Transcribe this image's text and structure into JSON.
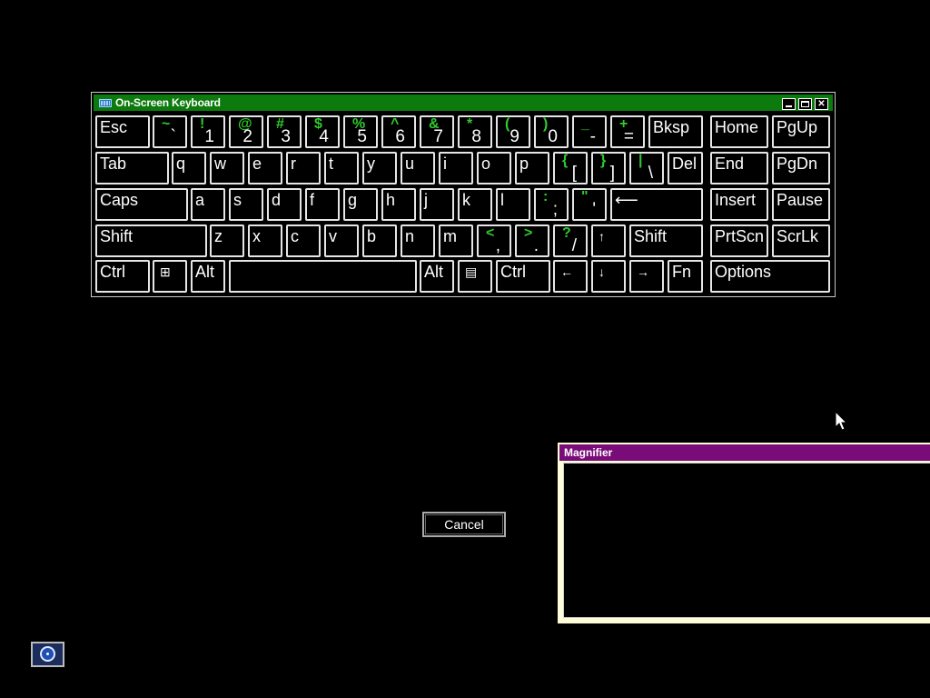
{
  "osk": {
    "title": "On-Screen Keyboard",
    "controls": {
      "minimize": "",
      "maximize": "",
      "close": "✕"
    },
    "keys": {
      "esc": "Esc",
      "tilde_hi": "~",
      "tilde_lo": "`",
      "k1_hi": "!",
      "k1_lo": "1",
      "k2_hi": "@",
      "k2_lo": "2",
      "k3_hi": "#",
      "k3_lo": "3",
      "k4_hi": "$",
      "k4_lo": "4",
      "k5_hi": "%",
      "k5_lo": "5",
      "k6_hi": "^",
      "k6_lo": "6",
      "k7_hi": "&",
      "k7_lo": "7",
      "k8_hi": "*",
      "k8_lo": "8",
      "k9_hi": "(",
      "k9_lo": "9",
      "k0_hi": ")",
      "k0_lo": "0",
      "minus_hi": "_",
      "minus_lo": "-",
      "plus_hi": "+",
      "plus_lo": "=",
      "bksp": "Bksp",
      "home": "Home",
      "pgup": "PgUp",
      "tab": "Tab",
      "q": "q",
      "w": "w",
      "e": "e",
      "r": "r",
      "t": "t",
      "y": "y",
      "u": "u",
      "i": "i",
      "o": "o",
      "p": "p",
      "lbr_hi": "{",
      "lbr_lo": "[",
      "rbr_hi": "}",
      "rbr_lo": "]",
      "pipe_hi": "|",
      "pipe_lo": "\\",
      "del": "Del",
      "end": "End",
      "pgdn": "PgDn",
      "caps": "Caps",
      "a": "a",
      "s": "s",
      "d": "d",
      "f": "f",
      "g": "g",
      "h": "h",
      "j": "j",
      "k": "k",
      "l": "l",
      "semi_hi": ":",
      "semi_lo": ";",
      "quote_hi": "\"",
      "quote_lo": "'",
      "enter": "⟵",
      "insert": "Insert",
      "pause": "Pause",
      "shift_l": "Shift",
      "z": "z",
      "x": "x",
      "c": "c",
      "v": "v",
      "b": "b",
      "n": "n",
      "m": "m",
      "comma_hi": "<",
      "comma_lo": ",",
      "period_hi": ">",
      "period_lo": ".",
      "slash_hi": "?",
      "slash_lo": "/",
      "up": "↑",
      "shift_r": "Shift",
      "prtscn": "PrtScn",
      "scrlk": "ScrLk",
      "ctrl_l": "Ctrl",
      "win": "⊞",
      "alt_l": "Alt",
      "alt_r": "Alt",
      "menu": "▤",
      "ctrl_r": "Ctrl",
      "left": "←",
      "down": "↓",
      "right": "→",
      "fn": "Fn",
      "options": "Options"
    }
  },
  "magnifier": {
    "title": "Magnifier"
  },
  "cancel_button": "Cancel",
  "colors": {
    "osk_title": "#0c7a0c",
    "magnifier_title": "#7a0c7a",
    "shift_chars": "#2ecb2e"
  }
}
